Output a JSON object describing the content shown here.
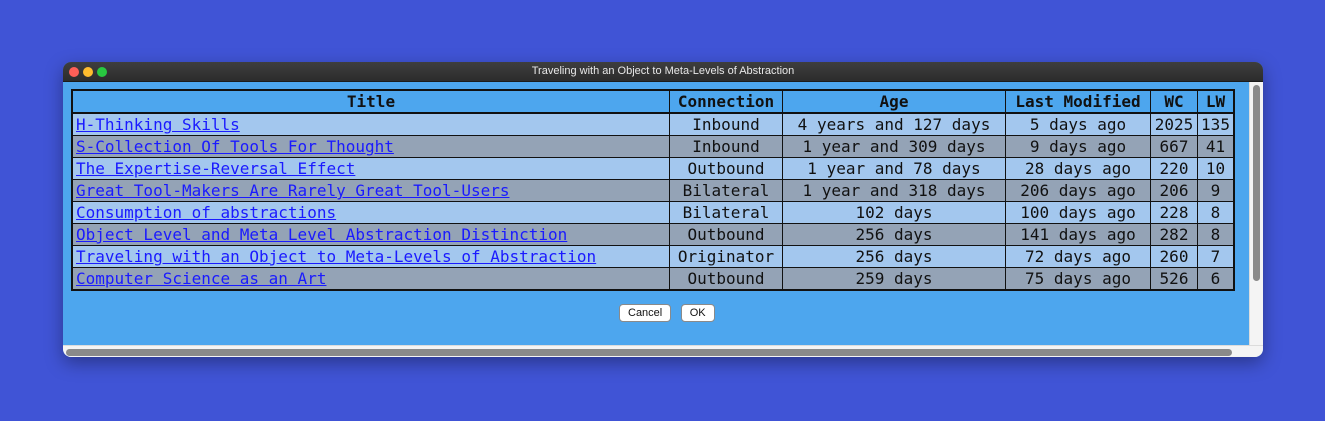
{
  "window": {
    "title": "Traveling with an Object to Meta-Levels of Abstraction"
  },
  "table": {
    "headers": [
      "Title",
      "Connection",
      "Age",
      "Last Modified",
      "WC",
      "LW"
    ],
    "rows": [
      {
        "title": "H-Thinking Skills",
        "connection": "Inbound",
        "age": "4 years and 127 days",
        "modified": "5 days ago",
        "wc": "2025",
        "lw": "135"
      },
      {
        "title": "S-Collection Of Tools For Thought",
        "connection": "Inbound",
        "age": "1 year and 309 days",
        "modified": "9 days ago",
        "wc": "667",
        "lw": "41"
      },
      {
        "title": "The Expertise-Reversal Effect",
        "connection": "Outbound",
        "age": "1 year and 78 days",
        "modified": "28 days ago",
        "wc": "220",
        "lw": "10"
      },
      {
        "title": "Great Tool-Makers Are Rarely Great Tool-Users",
        "connection": "Bilateral",
        "age": "1 year and 318 days",
        "modified": "206 days ago",
        "wc": "206",
        "lw": "9"
      },
      {
        "title": "Consumption of abstractions",
        "connection": "Bilateral",
        "age": "102 days",
        "modified": "100 days ago",
        "wc": "228",
        "lw": "8"
      },
      {
        "title": "Object Level and Meta Level Abstraction Distinction",
        "connection": "Outbound",
        "age": "256 days",
        "modified": "141 days ago",
        "wc": "282",
        "lw": "8"
      },
      {
        "title": "Traveling with an Object to Meta-Levels of Abstraction",
        "connection": "Originator",
        "age": "256 days",
        "modified": "72 days ago",
        "wc": "260",
        "lw": "7"
      },
      {
        "title": "Computer Science as an Art",
        "connection": "Outbound",
        "age": "259 days",
        "modified": "75 days ago",
        "wc": "526",
        "lw": "6"
      }
    ]
  },
  "buttons": {
    "cancel": "Cancel",
    "ok": "OK"
  },
  "icons": {
    "close": "close-icon",
    "minimize": "minimize-icon",
    "maximize": "maximize-icon"
  },
  "colors": {
    "desktop": "#4054d6",
    "window_bg": "#4da6ee",
    "row_odd": "#a3c7ee",
    "row_even": "#94a3b6",
    "link": "#1a1aff"
  }
}
